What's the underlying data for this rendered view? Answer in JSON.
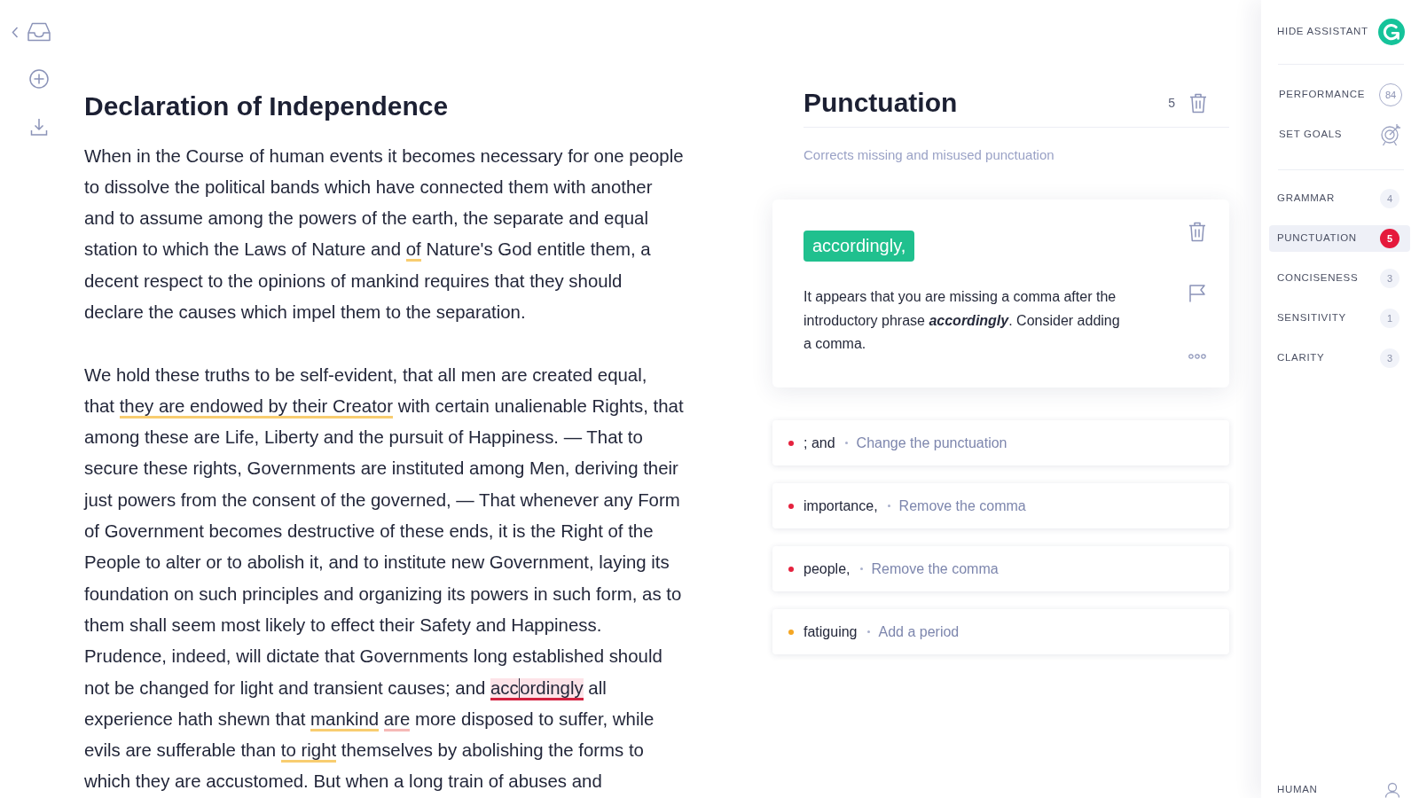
{
  "document": {
    "title": "Declaration of Independence",
    "paragraphs": [
      {
        "lines": [
          [
            {
              "kind": "text",
              "text": "When in the Course of human events it becomes necessary for one people"
            }
          ],
          [
            {
              "kind": "text",
              "text": "to dissolve the political bands which have connected them with another"
            }
          ],
          [
            {
              "kind": "text",
              "text": "and to assume among the powers of the earth, the separate and equal"
            }
          ],
          [
            {
              "kind": "text",
              "text": "station to which the Laws of Nature and "
            },
            {
              "kind": "issue",
              "text": "of",
              "color": "#f8cd70",
              "selected": false
            },
            {
              "kind": "text",
              "text": " Nature's God entitle them, a"
            }
          ],
          [
            {
              "kind": "text",
              "text": "decent respect to the opinions of mankind requires that they should"
            }
          ],
          [
            {
              "kind": "text",
              "text": "declare the causes which impel them to the separation."
            }
          ]
        ]
      },
      {
        "lines": [
          [
            {
              "kind": "text",
              "text": "We hold these truths to be self-evident, that all men are created equal,"
            }
          ],
          [
            {
              "kind": "text",
              "text": "that "
            },
            {
              "kind": "issue",
              "text": "they are endowed by their Creator",
              "color": "#f8cd70",
              "selected": false
            },
            {
              "kind": "text",
              "text": " with certain unalienable Rights, that"
            }
          ],
          [
            {
              "kind": "text",
              "text": "among these are Life, Liberty and the pursuit of Happiness. — That to"
            }
          ],
          [
            {
              "kind": "text",
              "text": "secure these rights, Governments are instituted among Men, deriving their"
            }
          ],
          [
            {
              "kind": "text",
              "text": "just powers from the consent of the governed, — That whenever any Form"
            }
          ],
          [
            {
              "kind": "text",
              "text": "of Government becomes destructive of these ends, it is the Right of the"
            }
          ],
          [
            {
              "kind": "text",
              "text": "People to alter or to abolish it, and to institute new Government, laying its"
            }
          ],
          [
            {
              "kind": "text",
              "text": "foundation on such principles and organizing its powers in such form, as to"
            }
          ],
          [
            {
              "kind": "text",
              "text": "them shall seem most likely to effect their Safety and Happiness."
            }
          ],
          [
            {
              "kind": "text",
              "text": "Prudence, indeed, will dictate that Governments long established should"
            }
          ],
          [
            {
              "kind": "text",
              "text": "not be changed for light and transient causes; and "
            },
            {
              "kind": "issue",
              "text": "acc",
              "text_after_caret": "ordingly",
              "color": "#d3203f",
              "selected": true
            },
            {
              "kind": "text",
              "text": " all"
            }
          ],
          [
            {
              "kind": "text",
              "text": "experience hath shewn that "
            },
            {
              "kind": "issue",
              "text": "mankind",
              "color": "#f8cd70",
              "selected": false
            },
            {
              "kind": "space"
            },
            {
              "kind": "issue",
              "text": "are",
              "color": "#f6b9b6",
              "selected": false
            },
            {
              "kind": "text",
              "text": " more disposed to suffer, while"
            }
          ],
          [
            {
              "kind": "text",
              "text": "evils are sufferable than "
            },
            {
              "kind": "issue",
              "text": "to right",
              "color": "#f8cd70",
              "selected": false
            },
            {
              "kind": "text",
              "text": " themselves by abolishing the forms to"
            }
          ],
          [
            {
              "kind": "text",
              "text": "which they are accustomed. But when a long train of abuses and"
            }
          ]
        ]
      }
    ]
  },
  "panel": {
    "title": "Punctuation",
    "count": "5",
    "description": "Corrects missing and misused punctuation",
    "active_card": {
      "replacement": "accordingly,",
      "explanation": "It appears that you are missing a comma after the introductory phrase **accordingly**. Consider adding a comma."
    },
    "suggestions": [
      {
        "text": "; and",
        "action": "Change the punctuation",
        "color": "#e5223e"
      },
      {
        "text": "importance,",
        "action": "Remove the comma",
        "color": "#e5223e"
      },
      {
        "text": "people,",
        "action": "Remove the comma",
        "color": "#e5223e"
      },
      {
        "text": "fatiguing",
        "action": "Add a period",
        "color": "#f5a623"
      }
    ]
  },
  "sidebar": {
    "toggle_label": "HIDE ASSISTANT",
    "tools": [
      {
        "kind": "score",
        "label": "PERFORMANCE",
        "score": "84"
      },
      {
        "kind": "goals",
        "label": "SET GOALS"
      }
    ],
    "categories": [
      {
        "label": "GRAMMAR",
        "count": "4",
        "selected": false
      },
      {
        "label": "PUNCTUATION",
        "count": "5",
        "selected": true
      },
      {
        "label": "CONCISENESS",
        "count": "3",
        "selected": false
      },
      {
        "label": "SENSITIVITY",
        "count": "1",
        "selected": false
      },
      {
        "label": "CLARITY",
        "count": "3",
        "selected": false
      }
    ],
    "footer_label": "HUMAN"
  }
}
